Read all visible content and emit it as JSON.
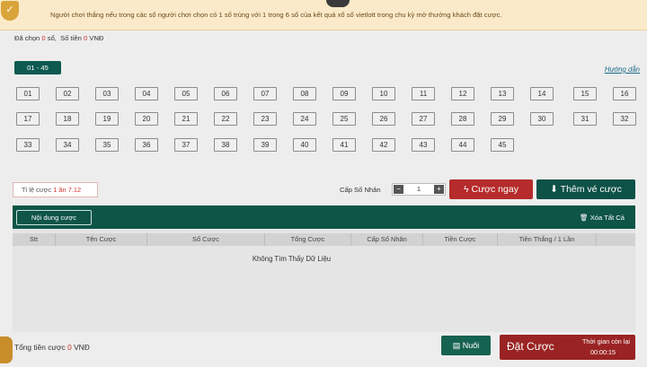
{
  "notice": {
    "badge_icon": "✓",
    "text": "Người chơi thắng nếu trong các số người chơi chọn có 1 số trùng với 1 trong 6 số của kết quả xổ số vietlott trong chu kỳ mở thưởng khách đặt cược."
  },
  "selection": {
    "selected_label": "Đã chọn",
    "selected_count": "0",
    "selected_unit": "số,",
    "amount_label": "Số tiền",
    "amount_value": "0",
    "amount_unit": "VNĐ"
  },
  "range_tab": "01 - 45",
  "guide_link": "Hướng dẫn",
  "numbers": [
    "01",
    "02",
    "03",
    "04",
    "05",
    "06",
    "07",
    "08",
    "09",
    "10",
    "11",
    "12",
    "13",
    "14",
    "15",
    "16",
    "17",
    "18",
    "19",
    "20",
    "21",
    "22",
    "23",
    "24",
    "25",
    "26",
    "27",
    "28",
    "29",
    "30",
    "31",
    "32",
    "33",
    "34",
    "35",
    "36",
    "37",
    "38",
    "39",
    "40",
    "41",
    "42",
    "43",
    "44",
    "45"
  ],
  "controls": {
    "ratio_prefix": "Tỉ lệ cược",
    "ratio_value": "1 ăn 7.12",
    "multiplier_label": "Cấp Số Nhân",
    "multiplier_value": "1",
    "minus": "−",
    "plus": "+",
    "bet_now": "ϟ Cược ngay",
    "add_ticket": "⬇ Thêm vé cược"
  },
  "bet_table": {
    "content_tab": "Nội dung cược",
    "clear_all": "🗑 Xóa Tất Cả",
    "columns": [
      "Stt",
      "Tên Cược",
      "Số Cược",
      "Tổng Cược",
      "Cấp Số Nhân",
      "Tiền Cược",
      "Tiền Thắng / 1 Lần"
    ],
    "empty_message": "Không Tìm Thấy Dữ Liệu"
  },
  "footer": {
    "total_label": "Tổng tiền cược",
    "total_value": "0",
    "total_unit": "VNĐ",
    "nuoi_label": "▤ Nuôi",
    "place_bet_label": "Đặt Cược",
    "timer_label": "Thời gian còn lại",
    "timer_value": "00:00:15"
  }
}
